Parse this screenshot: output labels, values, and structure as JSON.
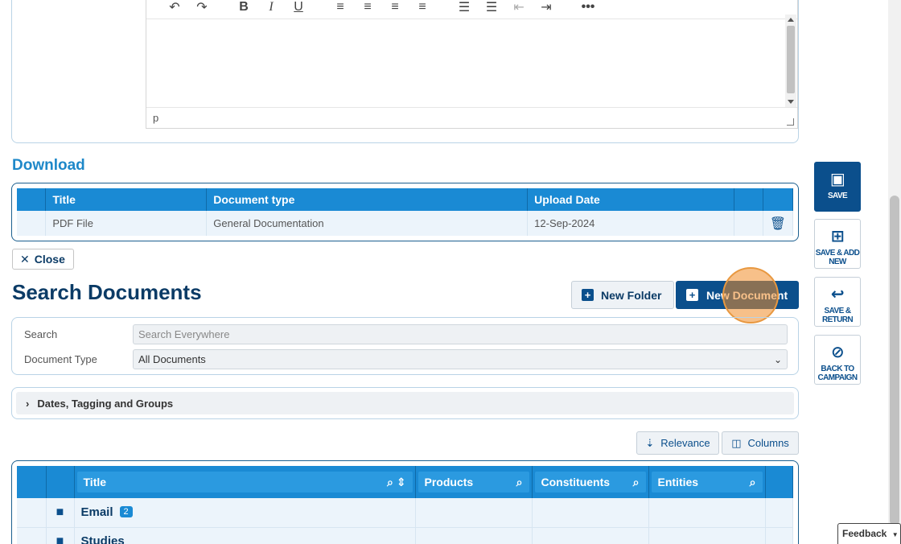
{
  "editor": {
    "toolbar_icons": [
      "undo-icon",
      "redo-icon",
      "bold-icon",
      "italic-icon",
      "underline-icon",
      "align-left-icon",
      "align-center-icon",
      "align-right-icon",
      "justify-icon",
      "bullet-list-icon",
      "numbered-list-icon",
      "outdent-icon",
      "indent-icon",
      "more-icon"
    ],
    "status_path": "p"
  },
  "download": {
    "heading": "Download",
    "columns": [
      "Title",
      "Document type",
      "Upload Date"
    ],
    "rows": [
      {
        "title": "PDF File",
        "document_type": "General Documentation",
        "upload_date": "12-Sep-2024"
      }
    ]
  },
  "close_button": {
    "label": "Close"
  },
  "search_documents": {
    "heading": "Search Documents",
    "new_folder_label": "New Folder",
    "new_document_label": "New Document",
    "search_label": "Search",
    "search_placeholder": "Search Everywhere",
    "document_type_label": "Document Type",
    "document_type_value": "All Documents",
    "filters_label": "Dates, Tagging and Groups",
    "relevance_label": "Relevance",
    "columns_label": "Columns"
  },
  "results": {
    "columns": [
      "Title",
      "Products",
      "Constituents",
      "Entities"
    ],
    "rows": [
      {
        "name": "Email",
        "count": "2"
      },
      {
        "name": "Studies",
        "count": ""
      }
    ]
  },
  "actions": {
    "save": "SAVE",
    "save_add_new": "SAVE & ADD NEW",
    "save_return": "SAVE & RETURN",
    "back_to_campaign": "BACK TO CAMPAIGN"
  },
  "feedback_label": "Feedback",
  "colors": {
    "primary": "#0b4f8c",
    "header_blue": "#1a8ad4",
    "highlight": "#f08c28"
  }
}
